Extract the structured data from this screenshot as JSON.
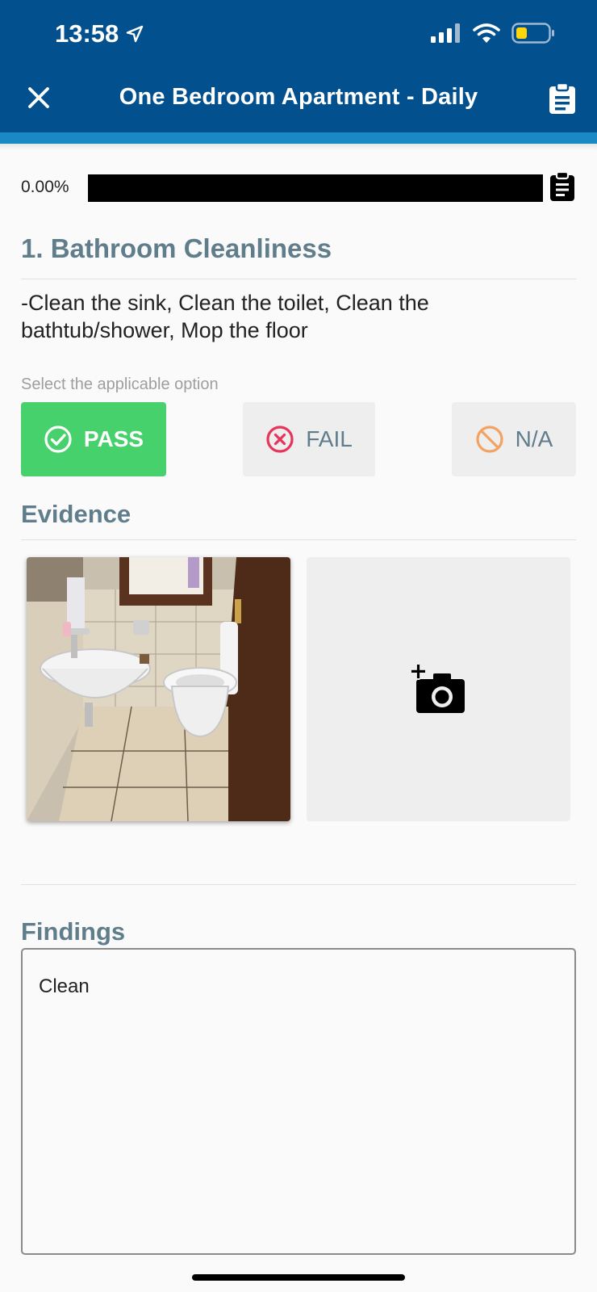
{
  "status_bar": {
    "time": "13:58"
  },
  "header": {
    "title": "One Bedroom Apartment - Daily"
  },
  "progress": {
    "text": "0.00%",
    "value": 0.0
  },
  "question": {
    "title": "1. Bathroom Cleanliness",
    "description": "-Clean the sink, Clean the toilet, Clean the bathtub/shower, Mop the floor",
    "hint": "Select the applicable option",
    "options": [
      {
        "label": "PASS",
        "selected": true,
        "color": "#47d16c"
      },
      {
        "label": "FAIL",
        "selected": false,
        "color": "#e8345a"
      },
      {
        "label": "N/A",
        "selected": false,
        "color": "#f4a261"
      }
    ]
  },
  "evidence": {
    "title": "Evidence"
  },
  "findings": {
    "title": "Findings",
    "value": "Clean"
  },
  "colors": {
    "header": "#03508f",
    "accent": "#1a8ac4",
    "section_title": "#607d8b"
  }
}
